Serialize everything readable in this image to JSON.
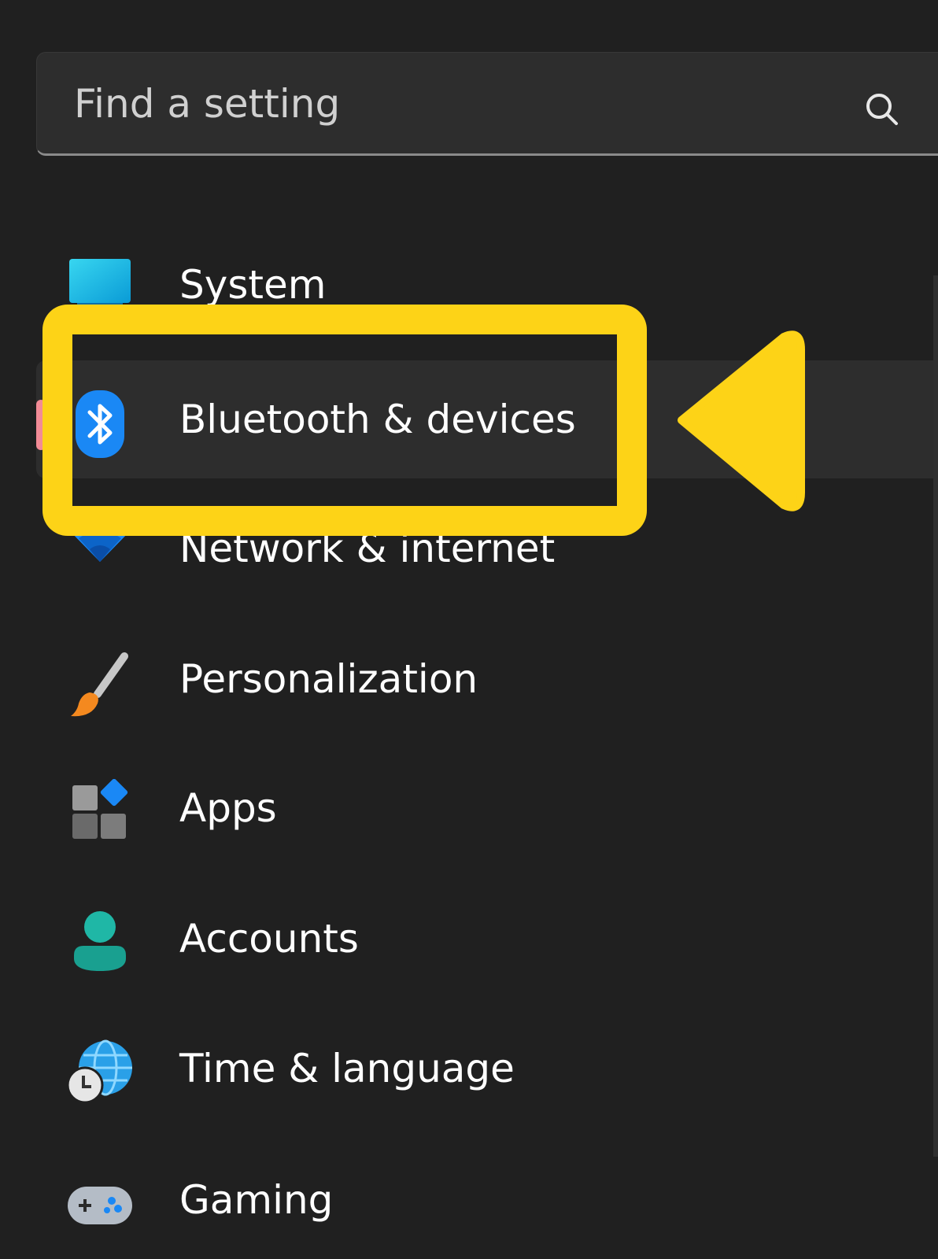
{
  "search": {
    "placeholder": "Find a setting",
    "icon": "search-icon"
  },
  "nav": {
    "items": [
      {
        "label": "System",
        "icon": "system-icon"
      },
      {
        "label": "Bluetooth & devices",
        "icon": "bluetooth-icon",
        "selected": true
      },
      {
        "label": "Network & internet",
        "icon": "wifi-icon"
      },
      {
        "label": "Personalization",
        "icon": "paintbrush-icon"
      },
      {
        "label": "Apps",
        "icon": "apps-icon"
      },
      {
        "label": "Accounts",
        "icon": "person-icon"
      },
      {
        "label": "Time & language",
        "icon": "globe-clock-icon"
      },
      {
        "label": "Gaming",
        "icon": "gamepad-icon"
      }
    ]
  },
  "colors": {
    "background": "#202020",
    "selected_row": "#2d2d2d",
    "selection_indicator": "#f28b96",
    "callout": "#fdd317",
    "bluetooth_blue": "#1a88f5"
  }
}
